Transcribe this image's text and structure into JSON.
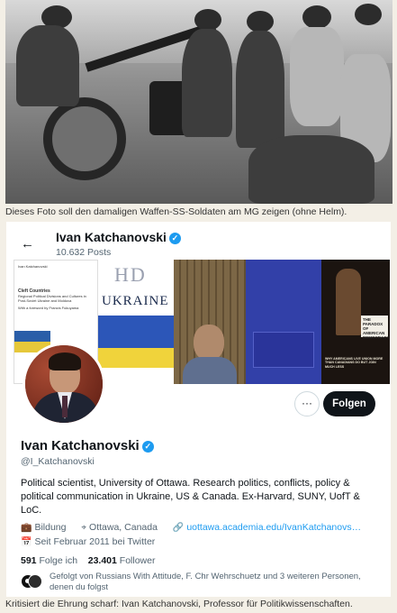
{
  "photo": {
    "caption": "Dieses Foto soll den damaligen Waffen-SS-Soldaten am MG zeigen (ohne Helm)."
  },
  "profile": {
    "header_name": "Ivan Katchanovski",
    "posts": "10.632 Posts",
    "name": "Ivan Katchanovski",
    "handle": "@I_Katchanovski",
    "follow_label": "Folgen",
    "more_label": "···",
    "bio": "Political scientist, University of Ottawa. Research politics, conflicts, policy & political communication in Ukraine, US & Canada. Ex-Harvard, SUNY, UofT & LoC.",
    "category": "Bildung",
    "location": "Ottawa, Canada",
    "website": "uottawa.academia.edu/IvanKatchanovs…",
    "joined": "Seit Februar 2011 bei Twitter",
    "following_count": "591",
    "following_label": "Folge ich",
    "followers_count": "23.401",
    "followers_label": "Follower",
    "followed_by": "Gefolgt von Russians With Attitude, F. Chr Wehrschuetz und 3 weiteren Personen, denen du folgst"
  },
  "banner": {
    "book1_title": "Cleft Countries",
    "book1_sub": "Regional Political Divisions and Cultures in Post-Soviet Ukraine and Moldova",
    "book1_author": "Ivan Katchanovski",
    "book1_foreword": "With a foreword by Francis Fukuyama",
    "book2_hd": "HD",
    "book2_title": "UKRAINE",
    "book5_title": "THE PARADOX OF AMERICAN DEMOCRACY",
    "book5_sub": "WHY AMERICANS LIVE UNION MORE THAN CANADIANS DO BUT JOIN MUCH LESS"
  },
  "article": {
    "caption": "Kritisiert die Ehrung scharf: Ivan Katchanovski, Professor für Politikwissenschaften."
  },
  "colors": {
    "verified": "#1d9bf0",
    "link": "#1d9bf0",
    "follow_button": "#0f1419"
  },
  "icons": [
    "back-arrow-icon",
    "verified-badge-icon",
    "briefcase-icon",
    "location-pin-icon",
    "link-icon",
    "calendar-icon",
    "more-icon"
  ]
}
